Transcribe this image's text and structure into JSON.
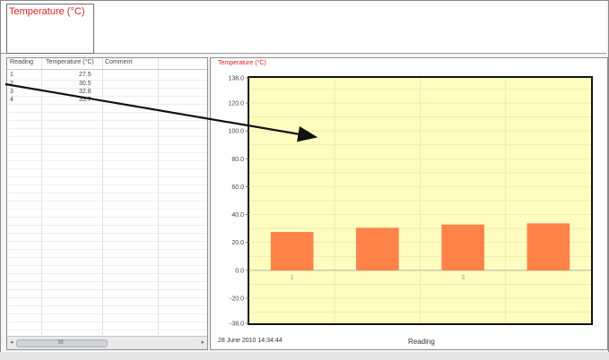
{
  "meter": {
    "title": "Temperature (°C)"
  },
  "table": {
    "columns": [
      "Reading",
      "Temperature (°C)",
      "Comment"
    ],
    "rows": [
      {
        "reading": "1",
        "temperature": "27.5",
        "comment": ""
      },
      {
        "reading": "2",
        "temperature": "30.5",
        "comment": ""
      },
      {
        "reading": "3",
        "temperature": "32.8",
        "comment": ""
      },
      {
        "reading": "4",
        "temperature": "33.7",
        "comment": ""
      }
    ],
    "scroll": {
      "left_arrow": "◂",
      "right_arrow": "▸",
      "grip": "III"
    }
  },
  "chart": {
    "title": "Temperature (°C)",
    "footer_date": "28 June 2010  14:34:44",
    "xlabel": "Reading"
  },
  "chart_data": {
    "type": "bar",
    "title": "Temperature (°C)",
    "xlabel": "Reading",
    "ylabel": "Temperature (°C)",
    "categories": [
      "1",
      "2",
      "3",
      "4"
    ],
    "x_tick_labels": [
      "1",
      "",
      "3",
      ""
    ],
    "values": [
      27.5,
      30.5,
      32.8,
      33.7
    ],
    "ylim": [
      -38.0,
      138.0
    ],
    "y_ticks": [
      -38.0,
      -20.0,
      0.0,
      20.0,
      40.0,
      60.0,
      80.0,
      100.0,
      120.0,
      138.0
    ],
    "bar_color": "#ff8248",
    "plot_background": "#fffdbf",
    "grid": true
  },
  "colors": {
    "accent": "#d42020",
    "bar": "#ff8248",
    "plot_background": "#fffdbf"
  }
}
